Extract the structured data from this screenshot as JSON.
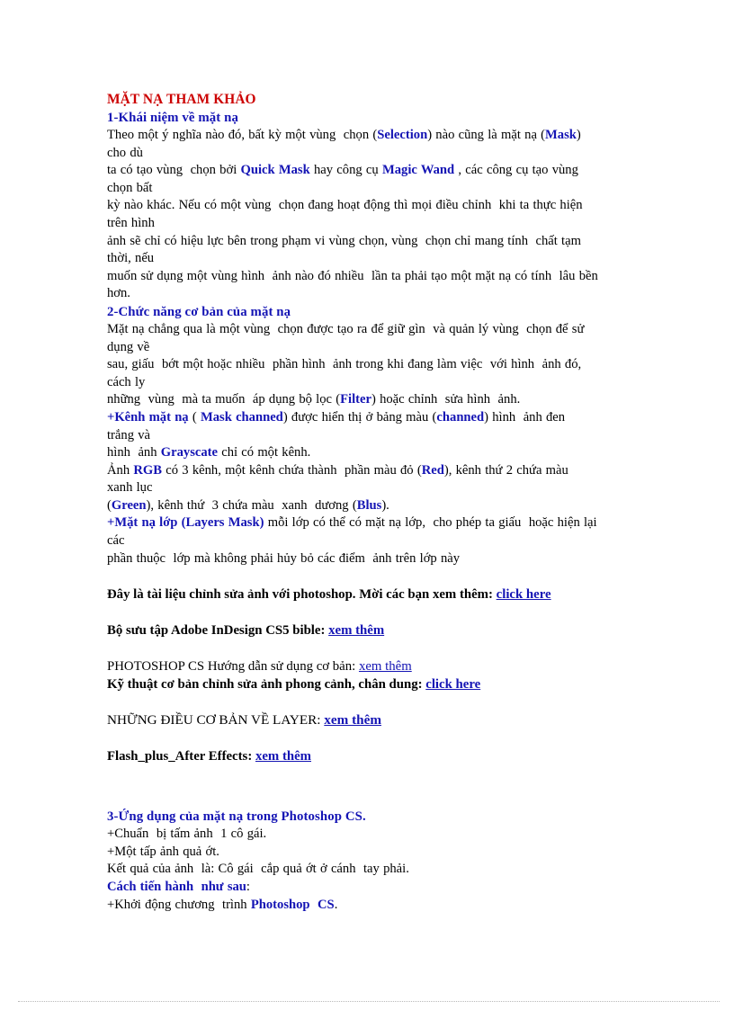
{
  "document": {
    "title": "MẶT NẠ THAM KHẢO",
    "colors": {
      "title_red": "#CC0000",
      "heading_blue": "#1414B4",
      "link_blue": "#1414B4",
      "body_black": "#000000"
    },
    "sections": {
      "s1": {
        "heading": "1-Khái niệm về mặt nạ",
        "l1a": "Theo một ý nghĩa nào đó, bất kỳ một vùng  chọn (",
        "l1b": "Selection",
        "l1c": ") nào cũng là mặt nạ (",
        "l1d": "Mask",
        "l1e": ")",
        "l2": "cho dù",
        "l3a": "ta có tạo vùng  chọn bởi ",
        "l3b": "Quick Mask",
        "l3c": " hay công cụ ",
        "l3d": "Magic Wand",
        "l3e": " , các công cụ tạo vùng",
        "l4": "chọn bất",
        "l5": "kỳ nào khác. Nếu có một vùng  chọn đang hoạt động thì mọi điều chỉnh  khi ta thực hiện",
        "l6": "trên hình",
        "l7": "ảnh sẽ chỉ có hiệu lực bên trong phạm vi vùng chọn, vùng  chọn chỉ mang tính  chất tạm",
        "l8": "thời, nếu",
        "l9": "muốn sử dụng một vùng hình  ảnh nào đó nhiều  lần ta phải tạo một mặt nạ có tính  lâu bền",
        "l10": "hơn."
      },
      "s2": {
        "heading": "2-Chức năng  cơ bản của mặt nạ",
        "l1": "Mặt nạ chẳng qua là một vùng  chọn được tạo ra để giữ gìn  và quản lý vùng  chọn để sử",
        "l2": "dụng về",
        "l3": "sau, giấu  bớt một hoặc nhiều  phần hình  ảnh trong khi đang làm việc  với hình  ảnh đó,",
        "l4": "cách ly",
        "l5a": "những  vùng  mà ta muốn  áp dụng bộ lọc (",
        "l5b": "Filter",
        "l5c": ") hoặc chỉnh  sửa hình  ảnh.",
        "l6a": "+Kênh mặt nạ",
        "l6b": " ( ",
        "l6c": "Mask channed",
        "l6d": ") được hiển thị ở bảng màu (",
        "l6e": "channed",
        "l6f": ") hình  ảnh đen",
        "l7": "trắng và",
        "l8a": "hình  ảnh ",
        "l8b": "Grayscate",
        "l8c": " chỉ có một kênh.",
        "l9a": "Ảnh ",
        "l9b": "RGB",
        "l9c": " có 3 kênh, một kênh chứa thành  phần màu đỏ (",
        "l9d": "Red",
        "l9e": "), kênh thứ 2 chứa màu",
        "l10": "xanh lục",
        "l11a": "(",
        "l11b": "Green",
        "l11c": "), kênh thứ  3 chứa màu  xanh  dương (",
        "l11d": "Blus",
        "l11e": ").",
        "l12a": "+Mặt nạ lớp (Layers Mask)",
        "l12b": " mỗi lớp có thể có mặt nạ lớp,  cho phép ta giấu  hoặc hiện lại",
        "l13": "các",
        "l14": "phần thuộc  lớp mà không phải hủy bỏ các điểm  ảnh trên lớp này"
      },
      "s3": {
        "heading": "3-Ứng dụng  của mặt nạ trong  Photoshop  CS.",
        "heading_pre": "3-Ứng dụng  của mặt nạ trong  ",
        "heading_ps": "Photoshop  CS",
        "heading_post": ".",
        "l1": "+Chuẩn  bị tấm ảnh  1 cô gái.",
        "l2": "+Một tấp ảnh quả ớt.",
        "l3": "Kết quả của ảnh  là: Cô gái  cắp quả ớt ở cánh  tay phải.",
        "l4a": "Cách tiến hành  như sau",
        "l4b": ":",
        "l5a": "+Khởi động chương  trình ",
        "l5b": "Photoshop  CS",
        "l5c": "."
      }
    },
    "links": [
      {
        "id": "link-photoshop-doc",
        "prefix": "Đây là tài liệu chỉnh  sửa ảnh với photoshop.  Mời các bạn xem thêm: ",
        "label": "click here",
        "bold": true
      },
      {
        "id": "link-indesign-bible",
        "prefix": "Bộ sưu tập Adobe InDesign CS5 bible: ",
        "label": "xem thêm",
        "bold": true
      },
      {
        "id": "link-photoshop-basic",
        "prefix": "PHOTOSHOP CS Hướng  dẫn sử dụng  cơ bản: ",
        "label": "xem thêm ",
        "bold": false
      },
      {
        "id": "link-landscape-portrait",
        "prefix": "Kỹ thuật  cơ bản chỉnh  sửa ảnh phong cảnh, chân  dung: ",
        "label": "click here",
        "bold": true
      },
      {
        "id": "link-layer-basics",
        "prefix": "NHỮNG ĐIỀU CƠ BẢN VỀ LAYER: ",
        "label": "xem thêm",
        "bold": true
      },
      {
        "id": "link-flash-after-effects",
        "prefix": "Flash_plus_After  Effects: ",
        "label": "xem thêm",
        "bold": true
      }
    ]
  }
}
